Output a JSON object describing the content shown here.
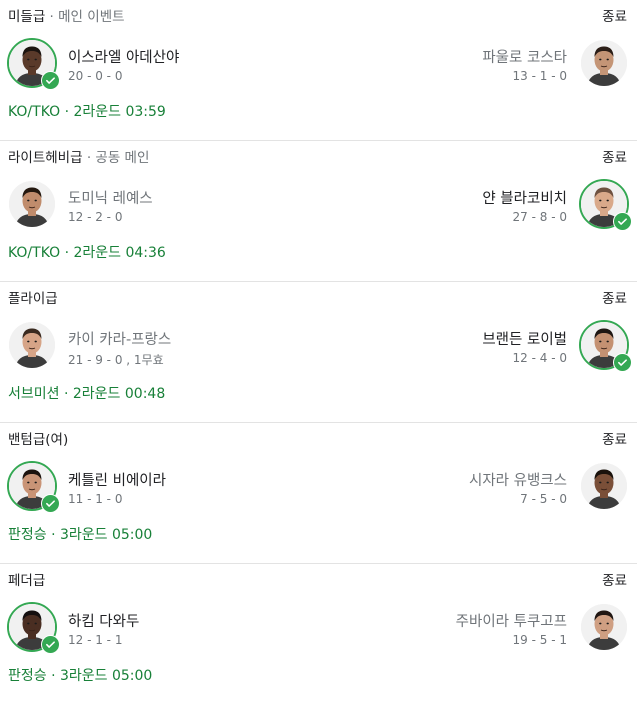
{
  "status_label": "종료",
  "result_separator": " · ",
  "colors": {
    "winner_accent": "#34a853",
    "result_text": "#188038",
    "secondary_text": "#70757a"
  },
  "fights": [
    {
      "weight_class": "미들급",
      "event_label": "메인 이벤트",
      "left": {
        "name": "이스라엘 아데산야",
        "record": "20 - 0 - 0",
        "winner": true,
        "skin": "#5a3a2a",
        "hair": "#1c1410"
      },
      "right": {
        "name": "파울로 코스타",
        "record": "13 - 1 - 0",
        "winner": false,
        "skin": "#c49576",
        "hair": "#2a1d16"
      },
      "method": "KO/TKO",
      "round_time": "2라운드 03:59"
    },
    {
      "weight_class": "라이트헤비급",
      "event_label": "공동 메인",
      "left": {
        "name": "도미닉 레예스",
        "record": "12 - 2 - 0",
        "winner": false,
        "skin": "#c08c6c",
        "hair": "#24180f"
      },
      "right": {
        "name": "얀 블라코비치",
        "record": "27 - 8 - 0",
        "winner": true,
        "skin": "#d9a98a",
        "hair": "#6e5140"
      },
      "method": "KO/TKO",
      "round_time": "2라운드 04:36"
    },
    {
      "weight_class": "플라이급",
      "event_label": "",
      "left": {
        "name": "카이 카라-프랑스",
        "record": "21 - 9 - 0 , 1무효",
        "winner": false,
        "skin": "#d6a487",
        "hair": "#3a2a20"
      },
      "right": {
        "name": "브랜든 로이벌",
        "record": "12 - 4 - 0",
        "winner": true,
        "skin": "#c49172",
        "hair": "#1f1713"
      },
      "method": "서브미션",
      "round_time": "2라운드 00:48"
    },
    {
      "weight_class": "밴텀급(여)",
      "event_label": "",
      "left": {
        "name": "케틀린 비에이라",
        "record": "11 - 1 - 0",
        "winner": true,
        "skin": "#c99476",
        "hair": "#1b120d"
      },
      "right": {
        "name": "시자라 유뱅크스",
        "record": "7 - 5 - 0",
        "winner": false,
        "skin": "#7a4f38",
        "hair": "#1a120c"
      },
      "method": "판정승",
      "round_time": "3라운드 05:00"
    },
    {
      "weight_class": "페더급",
      "event_label": "",
      "left": {
        "name": "하킴 다와두",
        "record": "12 - 1 - 1",
        "winner": true,
        "skin": "#4a2e22",
        "hair": "#151010"
      },
      "right": {
        "name": "주바이라 투쿠고프",
        "record": "19 - 5 - 1",
        "winner": false,
        "skin": "#cf9f82",
        "hair": "#201612"
      },
      "method": "판정승",
      "round_time": "3라운드 05:00"
    }
  ]
}
